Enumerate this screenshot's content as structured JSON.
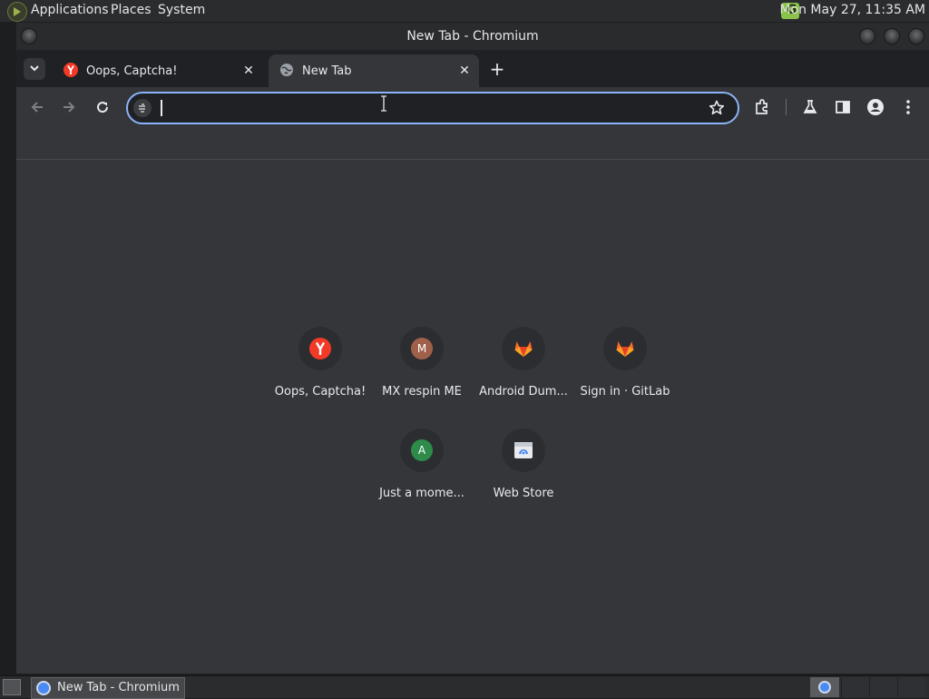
{
  "panel": {
    "menus": [
      "Applications",
      "Places",
      "System"
    ],
    "tray_letter": "G",
    "clock": "Mon May 27, 11:35 AM"
  },
  "window": {
    "title": "New Tab - Chromium"
  },
  "tabs": [
    {
      "label": "Oops, Captcha!",
      "favicon": "yandex-icon",
      "active": false
    },
    {
      "label": "New Tab",
      "favicon": "globe-icon",
      "active": true
    }
  ],
  "omnibox": {
    "value": "",
    "placeholder": ""
  },
  "shortcuts": [
    {
      "label": "Oops, Captcha!",
      "icon": "yandex-icon"
    },
    {
      "label": "MX respin ME",
      "icon": "letter-icon",
      "letter": "M",
      "color": "#a0614a"
    },
    {
      "label": "Android Dum...",
      "icon": "gitlab-icon"
    },
    {
      "label": "Sign in · GitLab",
      "icon": "gitlab-icon"
    },
    {
      "label": "Just a mome...",
      "icon": "letter-icon",
      "letter": "A",
      "color": "#2e8b4a"
    },
    {
      "label": "Web Store",
      "icon": "web-store-icon"
    }
  ],
  "taskbar": {
    "task_label": "New Tab - Chromium"
  },
  "colors": {
    "accent": "#8ab4f8",
    "ntp_background": "#35363a",
    "yandex_red": "#f33a27",
    "gitlab_orange": "#fc6d26"
  }
}
